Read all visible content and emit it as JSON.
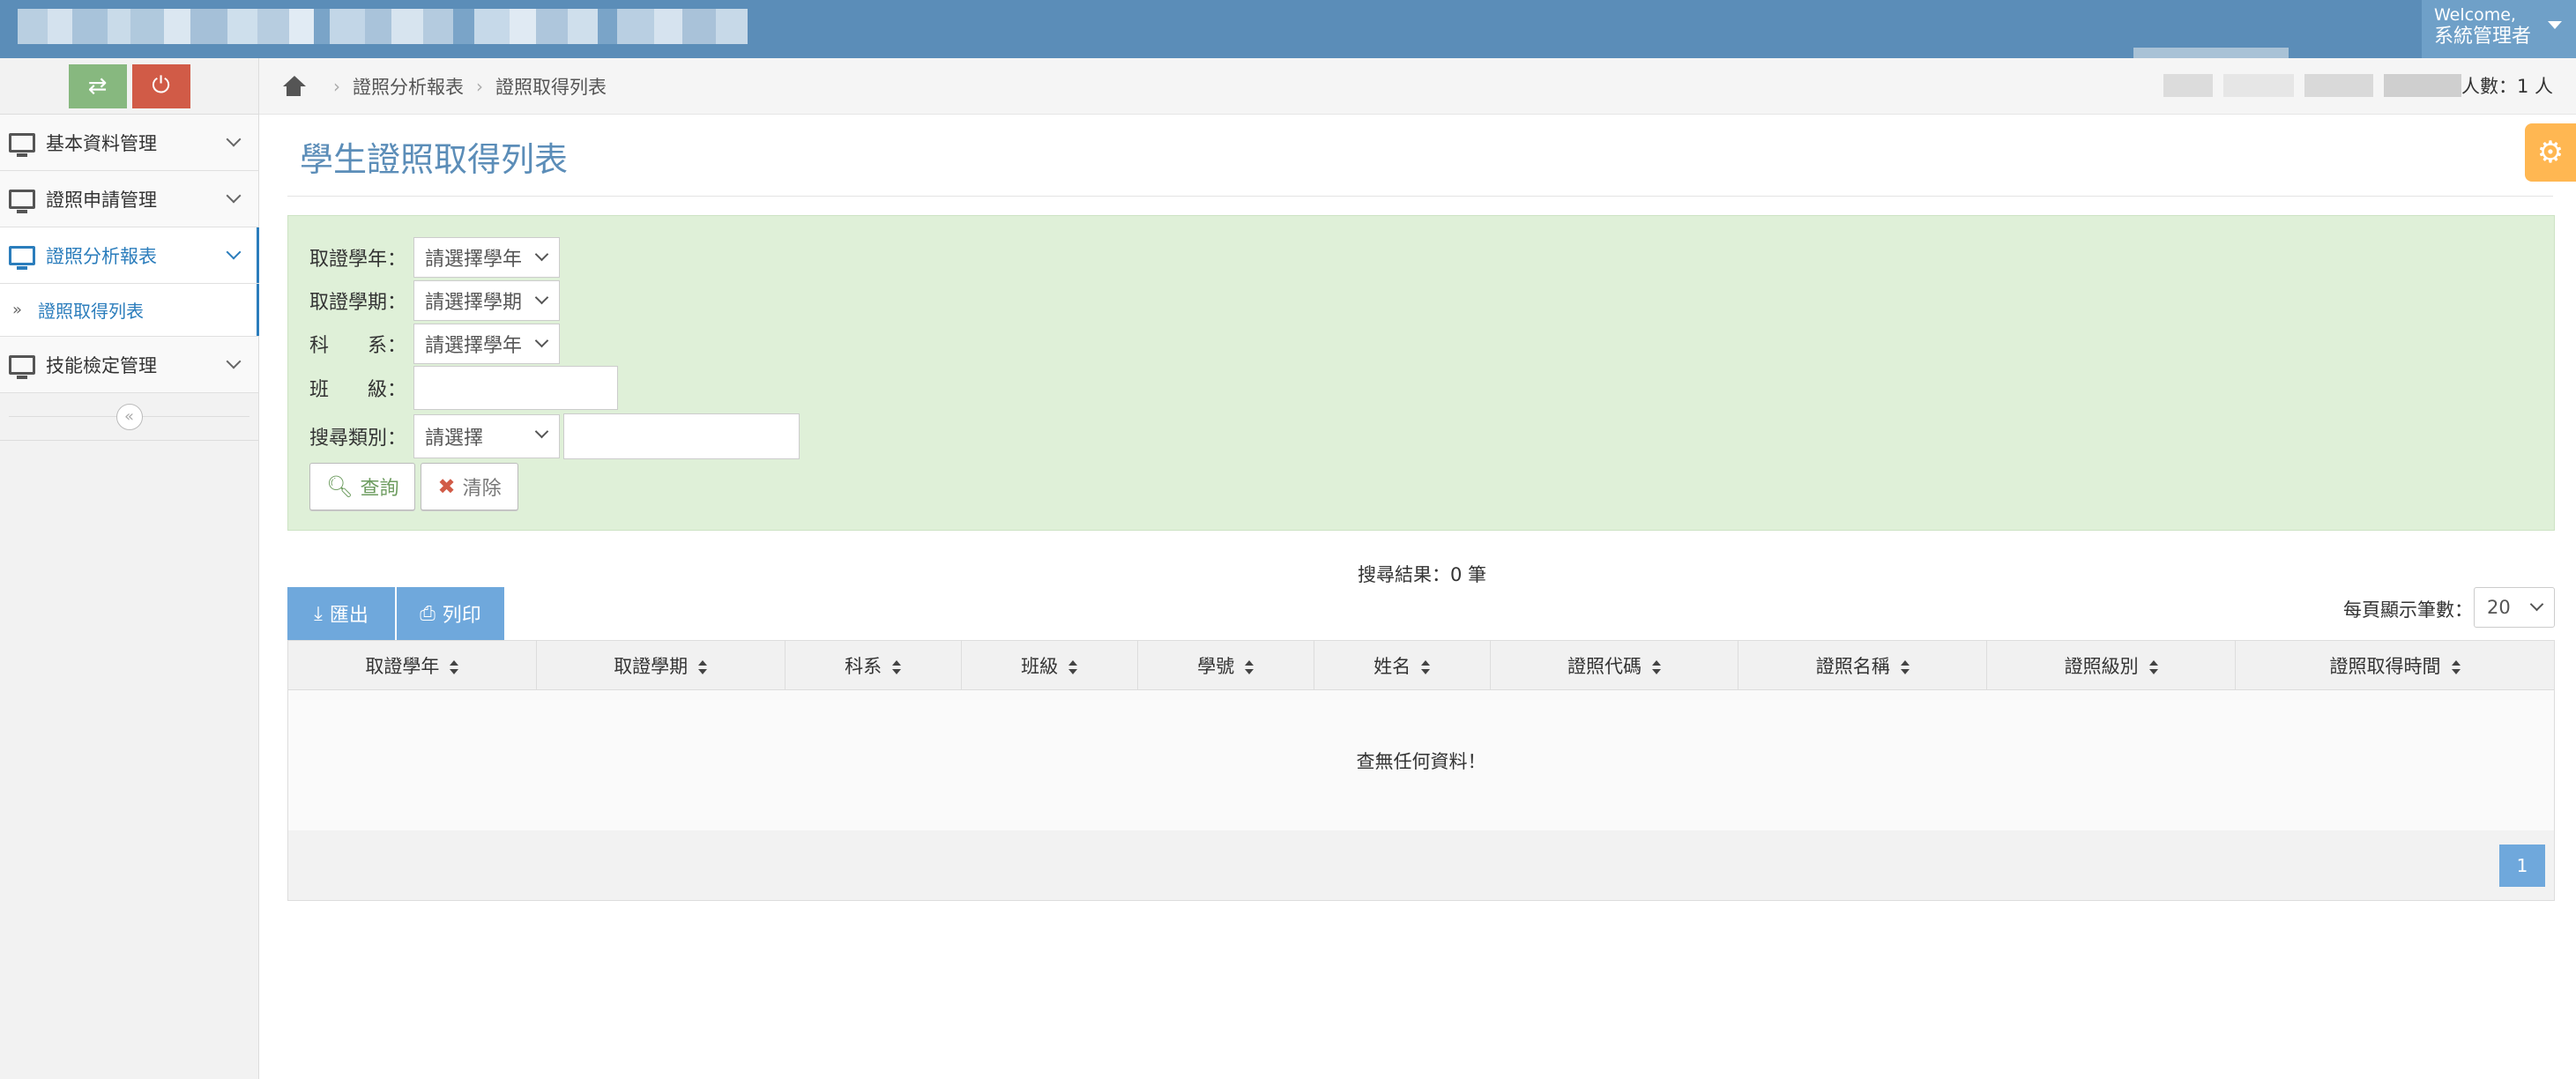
{
  "header": {
    "welcome": "Welcome,",
    "user": "系統管理者"
  },
  "sidebar": {
    "items": [
      {
        "label": "基本資料管理"
      },
      {
        "label": "證照申請管理"
      },
      {
        "label": "證照分析報表"
      },
      {
        "label": "技能檢定管理"
      }
    ],
    "sub_item": "證照取得列表",
    "collapse_glyph": "«"
  },
  "breadcrumb": {
    "items": [
      "證照分析報表",
      "證照取得列表"
    ],
    "separator": "›"
  },
  "online": {
    "text": "人數：1 人"
  },
  "page": {
    "title": "學生證照取得列表"
  },
  "search": {
    "year_label": "取證學年：",
    "year_value": "請選擇學年",
    "term_label": "取證學期：",
    "term_value": "請選擇學期",
    "dept_label": "科　　系：",
    "dept_value": "請選擇學年",
    "class_label": "班　　級：",
    "type_label": "搜尋類別：",
    "type_value": "請選擇",
    "query_label": "查詢",
    "clear_label": "清除"
  },
  "results": {
    "count_text": "搜尋結果：0 筆",
    "export_label": "匯出",
    "print_label": "列印",
    "page_size_label": "每頁顯示筆數：",
    "page_size": "20",
    "columns": [
      "取證學年",
      "取證學期",
      "科系",
      "班級",
      "學號",
      "姓名",
      "證照代碼",
      "證照名稱",
      "證照級別",
      "證照取得時間"
    ],
    "empty_text": "查無任何資料！",
    "current_page": "1"
  },
  "icons": {
    "switch": "switch-icon",
    "power": "power-icon",
    "home": "home-icon",
    "settings": "gear-icon",
    "search": "search-icon",
    "clear": "close-icon",
    "export": "download-icon",
    "print": "print-icon"
  },
  "colors": {
    "topbar": "#5b8db8",
    "accent": "#2b7dbc",
    "panel": "#dff0d8",
    "button": "#6fa8dc",
    "settings": "#ffb752"
  }
}
